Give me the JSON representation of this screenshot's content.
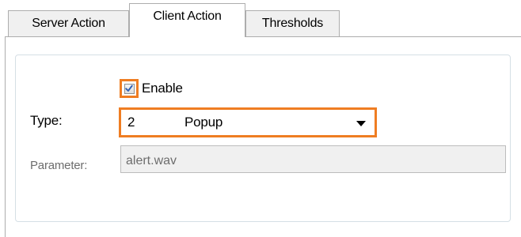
{
  "tabs": [
    {
      "label": "Server Action",
      "active": false
    },
    {
      "label": "Client Action",
      "active": true
    },
    {
      "label": "Thresholds",
      "active": false
    }
  ],
  "client_action": {
    "enable": {
      "label": "Enable",
      "checked": true
    },
    "type": {
      "label": "Type:",
      "code": "2",
      "value": "Popup"
    },
    "parameter": {
      "label": "Parameter:",
      "value": "alert.wav",
      "enabled": false
    }
  },
  "colors": {
    "highlight": "#ef7d22",
    "check": "#2f5fb3",
    "tab_border": "#adadad",
    "disabled_text": "#6d6d6d"
  }
}
